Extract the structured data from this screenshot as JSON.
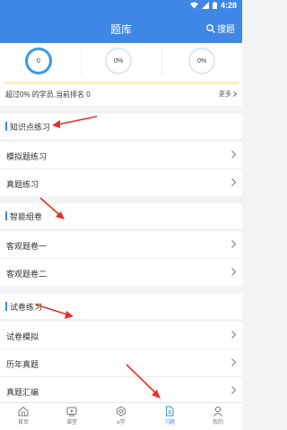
{
  "status_bar": {
    "time": "4:28"
  },
  "header": {
    "title": "题库",
    "search_label": "搜题"
  },
  "stats": [
    {
      "value": "0"
    },
    {
      "value": "0%"
    },
    {
      "value": "0%"
    }
  ],
  "rank": {
    "text": "超过0% 的学员,当前排名 0",
    "more_label": "更多",
    "progress": 0
  },
  "sections": [
    {
      "title": "知识点练习",
      "items": [
        "模拟题练习",
        "真题练习"
      ]
    },
    {
      "title": "智能组卷",
      "items": [
        "客观题卷一",
        "客观题卷二"
      ]
    },
    {
      "title": "试卷练习",
      "items": [
        "试卷模拟",
        "历年真题",
        "真题汇编"
      ]
    }
  ],
  "tabbar": {
    "items": [
      {
        "label": "首页",
        "icon": "home-icon"
      },
      {
        "label": "课堂",
        "icon": "video-icon"
      },
      {
        "label": "e学",
        "icon": "gear-icon"
      },
      {
        "label": "习题",
        "icon": "document-icon",
        "active": true
      },
      {
        "label": "我的",
        "icon": "person-icon"
      }
    ]
  },
  "colors": {
    "accent": "#3f87e6",
    "progress": "#f0c020",
    "arrow": "#e8302a"
  }
}
